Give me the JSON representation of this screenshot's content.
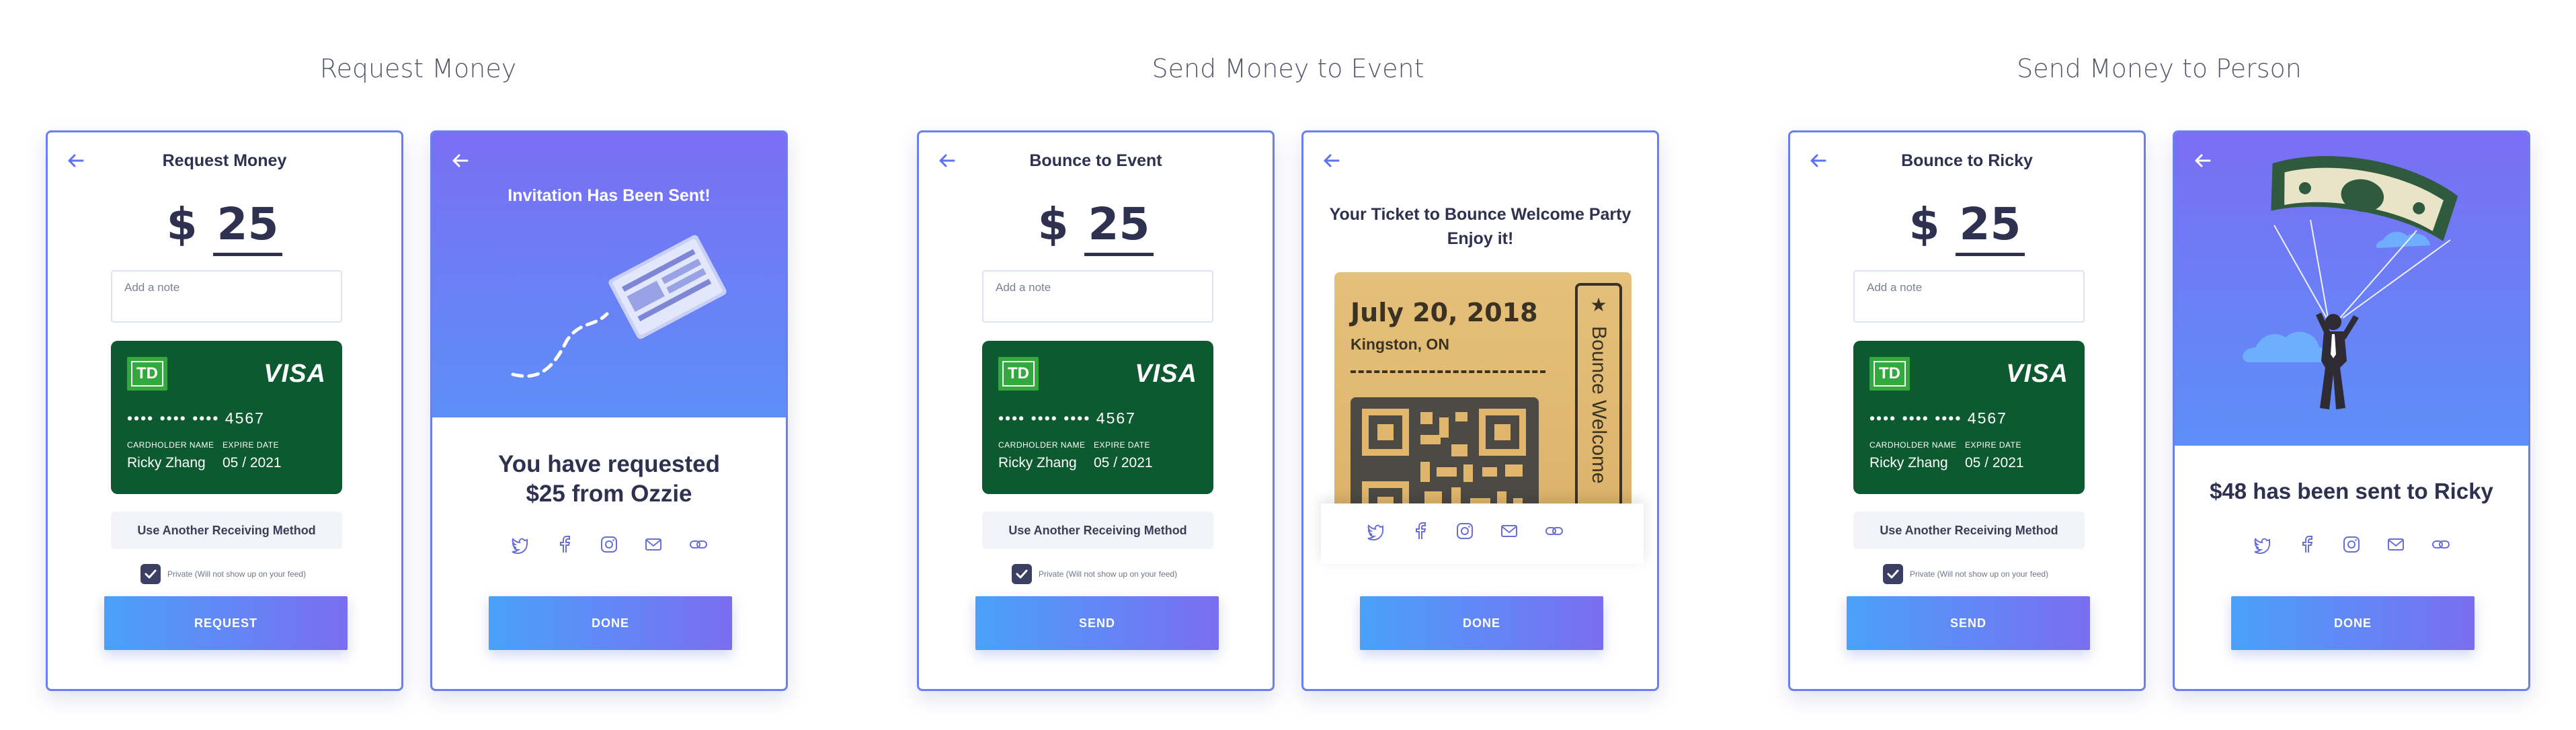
{
  "sections": [
    {
      "title": "Request Money"
    },
    {
      "title": "Send Money to Event"
    },
    {
      "title": "Send Money to Person"
    }
  ],
  "colors": {
    "primary": "#6a7ff0",
    "gradient_start": "#4aa1f9",
    "gradient_end": "#7a6df2",
    "card_green": "#0e5a30",
    "text_dark": "#2e3150"
  },
  "forms": [
    {
      "title": "Request Money",
      "currency": "$",
      "amount": "25",
      "note_placeholder": "Add a note",
      "card": {
        "number": "•••• •••• •••• 4567",
        "holder_label": "CARDHOLDER NAME",
        "holder": "Ricky Zhang",
        "expiry_label": "EXPIRE DATE",
        "expiry": "05 / 2021",
        "brand": "VISA",
        "bank": "TD"
      },
      "method_label": "Use Another Receiving Method",
      "private_label": "Private (Will not show up on your feed)",
      "button_label": "REQUEST"
    },
    {
      "title": "Bounce to Event",
      "currency": "$",
      "amount": "25",
      "note_placeholder": "Add a note",
      "card": {
        "number": "•••• •••• •••• 4567",
        "holder_label": "CARDHOLDER NAME",
        "holder": "Ricky Zhang",
        "expiry_label": "EXPIRE DATE",
        "expiry": "05 / 2021",
        "brand": "VISA",
        "bank": "TD"
      },
      "method_label": "Use Another Receiving Method",
      "private_label": "Private (Will not show up on your feed)",
      "button_label": "SEND"
    },
    {
      "title": "Bounce to Ricky",
      "currency": "$",
      "amount": "25",
      "note_placeholder": "Add a note",
      "card": {
        "number": "•••• •••• •••• 4567",
        "holder_label": "CARDHOLDER NAME",
        "holder": "Ricky Zhang",
        "expiry_label": "EXPIRE DATE",
        "expiry": "05 / 2021",
        "brand": "VISA",
        "bank": "TD"
      },
      "method_label": "Use Another Receiving Method",
      "private_label": "Private (Will not show up on your feed)",
      "button_label": "SEND"
    }
  ],
  "confirm_request": {
    "hero_title": "Invitation Has Been Sent!",
    "message_line1": "You have requested",
    "message_line2": "$25 from Ozzie",
    "button_label": "DONE"
  },
  "confirm_event": {
    "title_line1": "Your Ticket to Bounce Welcome Party",
    "title_line2": "Enjoy it!",
    "ticket_date": "July 20, 2018",
    "ticket_city": "Kingston, ON",
    "ticket_stub": "Bounce Welcome",
    "button_label": "DONE"
  },
  "confirm_person": {
    "message": "$48 has been sent to Ricky",
    "button_label": "DONE"
  },
  "social_icons": [
    "twitter-icon",
    "facebook-icon",
    "instagram-icon",
    "mail-icon",
    "link-icon"
  ]
}
